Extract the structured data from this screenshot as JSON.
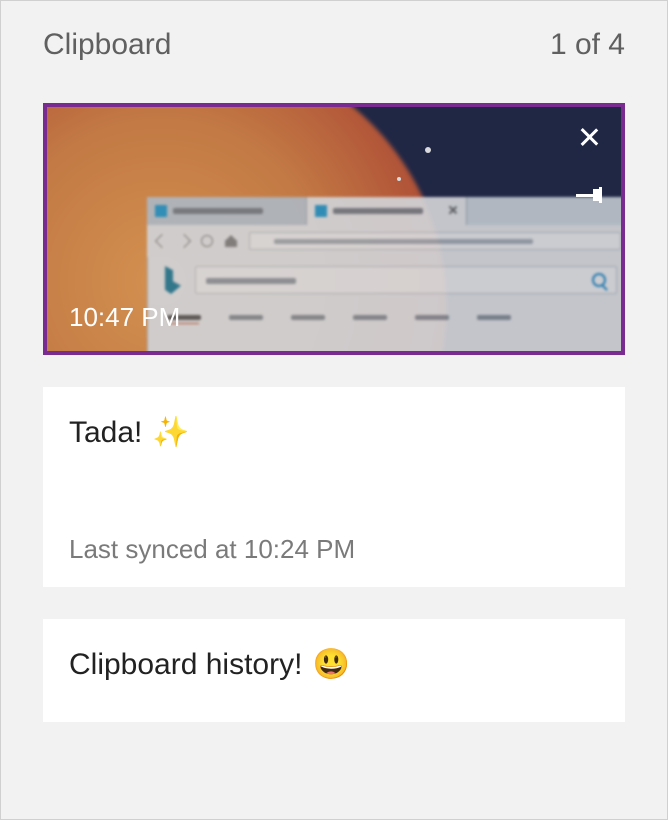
{
  "header": {
    "title": "Clipboard",
    "counter": "1 of 4"
  },
  "items": [
    {
      "kind": "image",
      "timestamp": "10:47 PM"
    },
    {
      "kind": "text",
      "text": "Tada!",
      "emoji": "✨",
      "sync_status": "Last synced at 10:24 PM"
    },
    {
      "kind": "text",
      "text": "Clipboard history!",
      "emoji": "😃"
    }
  ],
  "icons": {
    "close": "close-icon",
    "pin": "pin-icon"
  }
}
